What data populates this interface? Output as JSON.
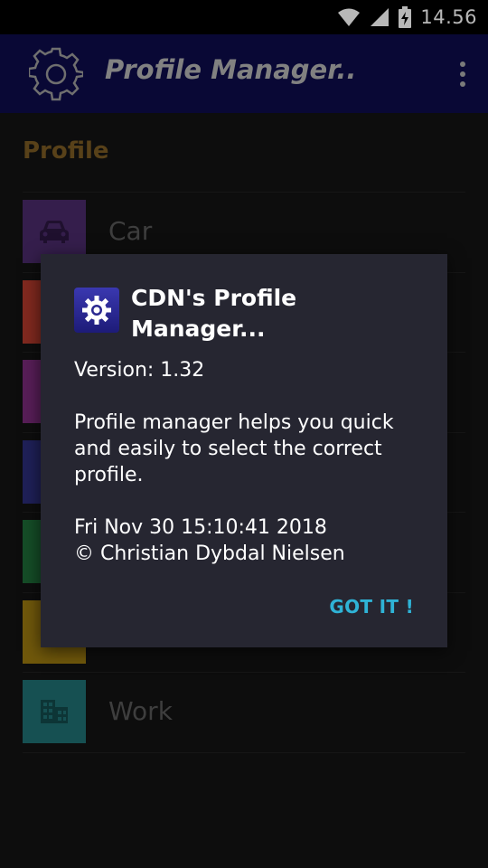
{
  "status_bar": {
    "time": "14.56",
    "icons": [
      "wifi-icon",
      "cell-signal-icon",
      "battery-charging-icon"
    ]
  },
  "app_bar": {
    "title": "Profile Manager..",
    "icon": "gear-icon",
    "menu_icon": "overflow-menu-icon"
  },
  "section": {
    "title": "Profile"
  },
  "profiles": [
    {
      "label": "Car",
      "color": "#4a2a6a",
      "icon": "car-icon"
    },
    {
      "label": "",
      "color": "#b33a2c",
      "icon": ""
    },
    {
      "label": "",
      "color": "#7a2a7a",
      "icon": ""
    },
    {
      "label": "",
      "color": "#2b2d7a",
      "icon": ""
    },
    {
      "label": "",
      "color": "#1e6b36",
      "icon": ""
    },
    {
      "label": "",
      "color": "#9b7a10",
      "icon": ""
    },
    {
      "label": "Work",
      "color": "#1f6f72",
      "icon": "building-icon"
    }
  ],
  "dialog": {
    "title": "CDN's Profile Manager...",
    "icon": "app-gear-icon",
    "version": "Version: 1.32",
    "description": "Profile manager helps you quick and easily to select the correct profile.",
    "date": "Fri Nov 30 15:10:41 2018",
    "copyright": "© Christian Dybdal Nielsen",
    "button": "GOT IT !"
  },
  "colors": {
    "app_bar": "#0d0c4a",
    "accent": "#2fb3d6",
    "section_title": "#7a5b23"
  }
}
